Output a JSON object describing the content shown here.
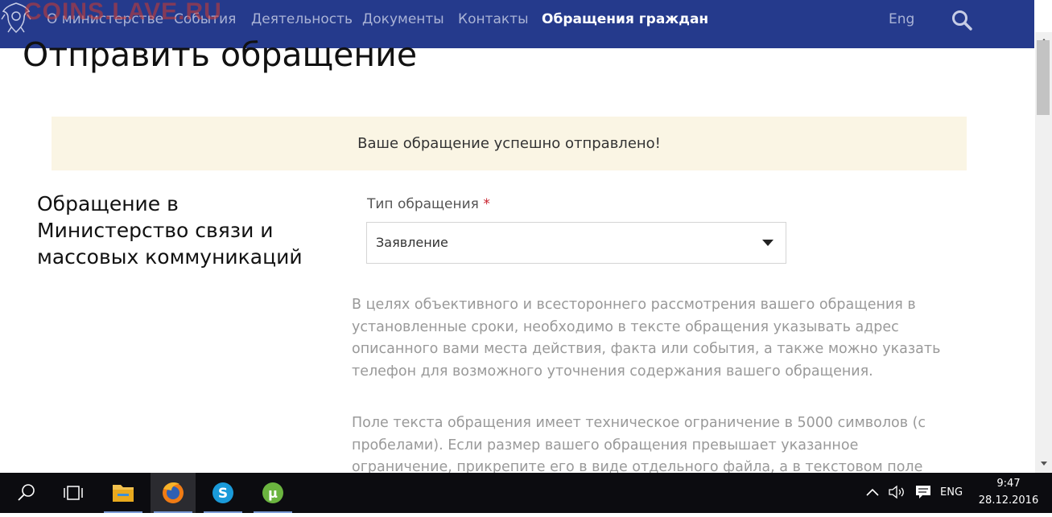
{
  "watermark": "COINS.LAVE.RU",
  "nav": {
    "items": [
      {
        "label": "О министерстве"
      },
      {
        "label": "События"
      },
      {
        "label": "Деятельность"
      },
      {
        "label": "Документы"
      },
      {
        "label": "Контакты"
      },
      {
        "label": "Обращения граждан"
      }
    ],
    "lang": "Eng"
  },
  "page": {
    "title": "Отправить обращение",
    "alert": "Ваше обращение успешно отправлено!",
    "section_heading": [
      "Обращение в",
      "Министерство связи и",
      "массовых коммуникаций"
    ],
    "field": {
      "label": "Тип обращения",
      "required_mark": "*",
      "value": "Заявление"
    },
    "paragraph1": [
      "В целях объективного и всестороннего рассмотрения вашего обращения в",
      "установленные сроки, необходимо в тексте обращения указывать адрес",
      "описанного вами места действия, факта или события, а также можно указать",
      "телефон для возможного уточнения содержания вашего обращения."
    ],
    "paragraph2": [
      "Поле текста обращения имеет техническое ограничение в 5000 символов (с",
      "пробелами). Если размер вашего обращения превышает указанное",
      "ограничение, прикрепите его в виде отдельного файла, а в текстовом поле"
    ]
  },
  "taskbar": {
    "apps": [
      "search-icon",
      "task-view-icon",
      "file-explorer-icon",
      "firefox-icon",
      "skype-icon",
      "utorrent-icon"
    ],
    "lang": "ENG",
    "time": "9:47",
    "date": "28.12.2016"
  },
  "colors": {
    "nav_bg": "#253a8c",
    "alert_bg": "#faf5e4",
    "required": "#c8202c",
    "taskbar_bg": "#0c0c10"
  }
}
